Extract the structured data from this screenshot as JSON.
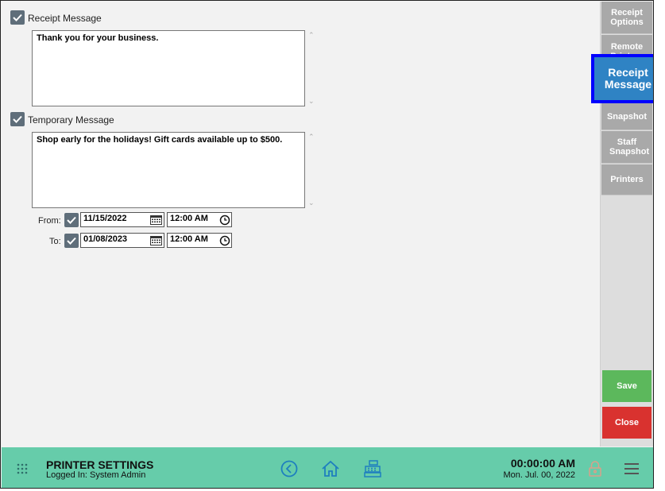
{
  "receipt_message": {
    "checkbox_label": "Receipt Message",
    "checked": true,
    "text": "Thank you for your business."
  },
  "temporary_message": {
    "checkbox_label": "Temporary Message",
    "checked": true,
    "text": "Shop early for the holidays! Gift cards available up to $500.",
    "from": {
      "label": "From:",
      "checked": true,
      "date": "11/15/2022",
      "time": "12:00 AM"
    },
    "to": {
      "label": "To:",
      "checked": true,
      "date": "01/08/2023",
      "time": "12:00 AM"
    }
  },
  "sidebar": {
    "items": [
      {
        "label": "Receipt Options"
      },
      {
        "label": "Remote Printers"
      },
      {
        "label": "Receipt Message",
        "active": true
      },
      {
        "label": "Snapshot"
      },
      {
        "label": "Staff Snapshot"
      },
      {
        "label": "Printers"
      }
    ],
    "save_label": "Save",
    "close_label": "Close"
  },
  "footer": {
    "title": "PRINTER SETTINGS",
    "logged_in": "Logged In:  System Admin",
    "time": "00:00:00 AM",
    "date": "Mon. Jul. 00, 2022"
  },
  "colors": {
    "footer_bg": "#66ccaa",
    "active_tab": "#2f83c4",
    "active_border": "#0000ff",
    "save": "#5cb85c",
    "close": "#d9322f",
    "sidebar_btn": "#a9a9a9",
    "checkbox": "#5f6e7a"
  },
  "icons": {
    "footer_left": "grid-dots-icon",
    "back": "back-circle-icon",
    "home": "home-icon",
    "register": "cash-register-icon",
    "lock": "lock-icon",
    "menu": "hamburger-menu-icon",
    "calendar": "calendar-icon",
    "clock": "clock-icon",
    "check": "checkmark-icon"
  }
}
